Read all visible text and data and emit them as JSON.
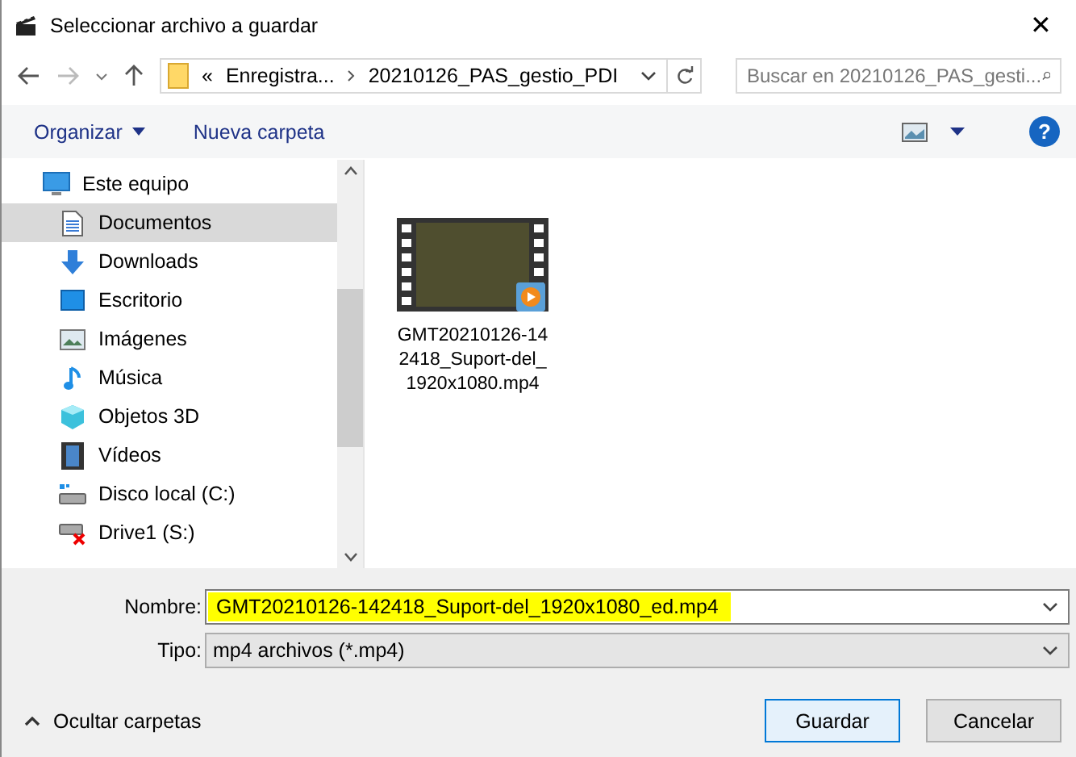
{
  "window": {
    "title": "Seleccionar archivo a guardar",
    "close": "✕"
  },
  "address": {
    "overflow": "«",
    "crumbs": [
      "Enregistra...",
      "20210126_PAS_gestio_PDI"
    ]
  },
  "search": {
    "placeholder": "Buscar en 20210126_PAS_gesti..."
  },
  "toolbar": {
    "organize": "Organizar",
    "new_folder": "Nueva carpeta",
    "help": "?"
  },
  "sidebar": {
    "items": [
      {
        "label": "Este equipo",
        "selected": false,
        "children": [
          {
            "label": "Documentos",
            "selected": true
          },
          {
            "label": "Downloads",
            "selected": false
          },
          {
            "label": "Escritorio",
            "selected": false
          },
          {
            "label": "Imágenes",
            "selected": false
          },
          {
            "label": "Música",
            "selected": false
          },
          {
            "label": "Objetos 3D",
            "selected": false
          },
          {
            "label": "Vídeos",
            "selected": false
          },
          {
            "label": "Disco local (C:)",
            "selected": false
          },
          {
            "label": "Drive1 (S:)",
            "selected": false
          }
        ]
      }
    ]
  },
  "files": [
    {
      "lines": [
        "GMT20210126-14",
        "2418_Suport-del_",
        "1920x1080.mp4"
      ]
    }
  ],
  "form": {
    "name_label": "Nombre:",
    "name_value": "GMT20210126-142418_Suport-del_1920x1080_ed.mp4",
    "type_label": "Tipo:",
    "type_value": "mp4 archivos (*.mp4)"
  },
  "footer": {
    "hide_folders": "Ocultar carpetas",
    "save": "Guardar",
    "cancel": "Cancelar"
  }
}
